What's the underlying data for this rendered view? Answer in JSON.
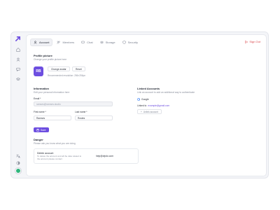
{
  "rail": {
    "icons": [
      "logo-icon",
      "home-icon",
      "users-icon",
      "chat-icon",
      "storage-icon"
    ],
    "bottom_icons": [
      "translate-icon",
      "theme-icon"
    ]
  },
  "tabs": [
    {
      "label": "Account",
      "icon": "user-icon",
      "active": true
    },
    {
      "label": "Members",
      "icon": "users-icon",
      "active": false
    },
    {
      "label": "Chat",
      "icon": "chat-icon",
      "active": false
    },
    {
      "label": "Storage",
      "icon": "storage-icon",
      "active": false
    },
    {
      "label": "Security",
      "icon": "shield-icon",
      "active": false
    }
  ],
  "sign_out_label": "Sign Out",
  "profile": {
    "title": "Profile picture",
    "subtitle": "Change your profile picture here",
    "initials": "RB",
    "change_label": "Change avatar",
    "reset_label": "Reset",
    "hint": "Recommended resolution: 256×256px"
  },
  "information": {
    "title": "Information",
    "subtitle": "Edit your personal information here",
    "email_label": "Email *",
    "email_value": "ramses@ramses.studio",
    "first_name_label": "First name *",
    "first_name_value": "Ramses",
    "last_name_label": "Last name *",
    "last_name_value": "Rostes",
    "save_label": "Save"
  },
  "linked": {
    "title": "Linked Accounts",
    "subtitle": "Link an account to add an additional way to authenticate",
    "provider": "Google",
    "linked_prefix": "Linked to",
    "linked_email": "example@gmail.com",
    "unlink_label": "Unlink account"
  },
  "danger": {
    "title": "Danger",
    "subtitle": "Please ask you know what you are doing",
    "box_title": "Delete account",
    "box_desc": "To delete the account and all the data related to the account please contact",
    "contact": "help@ofpdo.com"
  },
  "colors": {
    "accent": "#6d4ee0",
    "danger": "#d9464b",
    "success": "#2fb67c"
  }
}
